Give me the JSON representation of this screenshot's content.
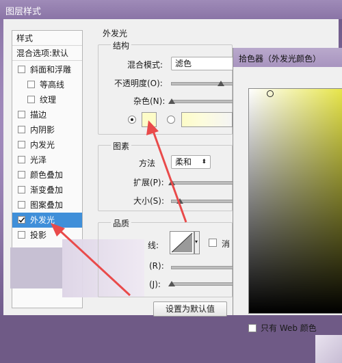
{
  "window": {
    "title": "图层样式"
  },
  "left_panel": {
    "header": "样式",
    "blend_options": "混合选项:默认",
    "items": [
      {
        "label": "斜面和浮雕"
      },
      {
        "label": "等高线"
      },
      {
        "label": "纹理"
      },
      {
        "label": "描边"
      },
      {
        "label": "内阴影"
      },
      {
        "label": "内发光"
      },
      {
        "label": "光泽"
      },
      {
        "label": "颜色叠加"
      },
      {
        "label": "渐变叠加"
      },
      {
        "label": "图案叠加"
      },
      {
        "label": "外发光"
      },
      {
        "label": "投影"
      }
    ]
  },
  "outer_glow": {
    "section_title": "外发光",
    "structure": {
      "title": "结构",
      "blend_mode_label": "混合模式:",
      "blend_mode_value": "滤色",
      "opacity_label": "不透明度(O):",
      "noise_label": "杂色(N):"
    },
    "elements": {
      "title": "图素",
      "method_label": "方法",
      "method_value": "柔和",
      "spread_label": "扩展(P):",
      "size_label": "大小(S):"
    },
    "quality": {
      "title": "品质",
      "contour_label": "线:",
      "antialias_label": "消",
      "range_label": "(R):",
      "jitter_label": "(J):"
    },
    "default_button": "设置为默认值"
  },
  "color_picker": {
    "title": "拾色器（外发光颜色）",
    "web_only_label": "只有 Web 颜色"
  },
  "colors": {
    "selected_item": "#3f8fd9",
    "glow_color": "#fdfcc8",
    "arrow": "#e94a4a"
  }
}
